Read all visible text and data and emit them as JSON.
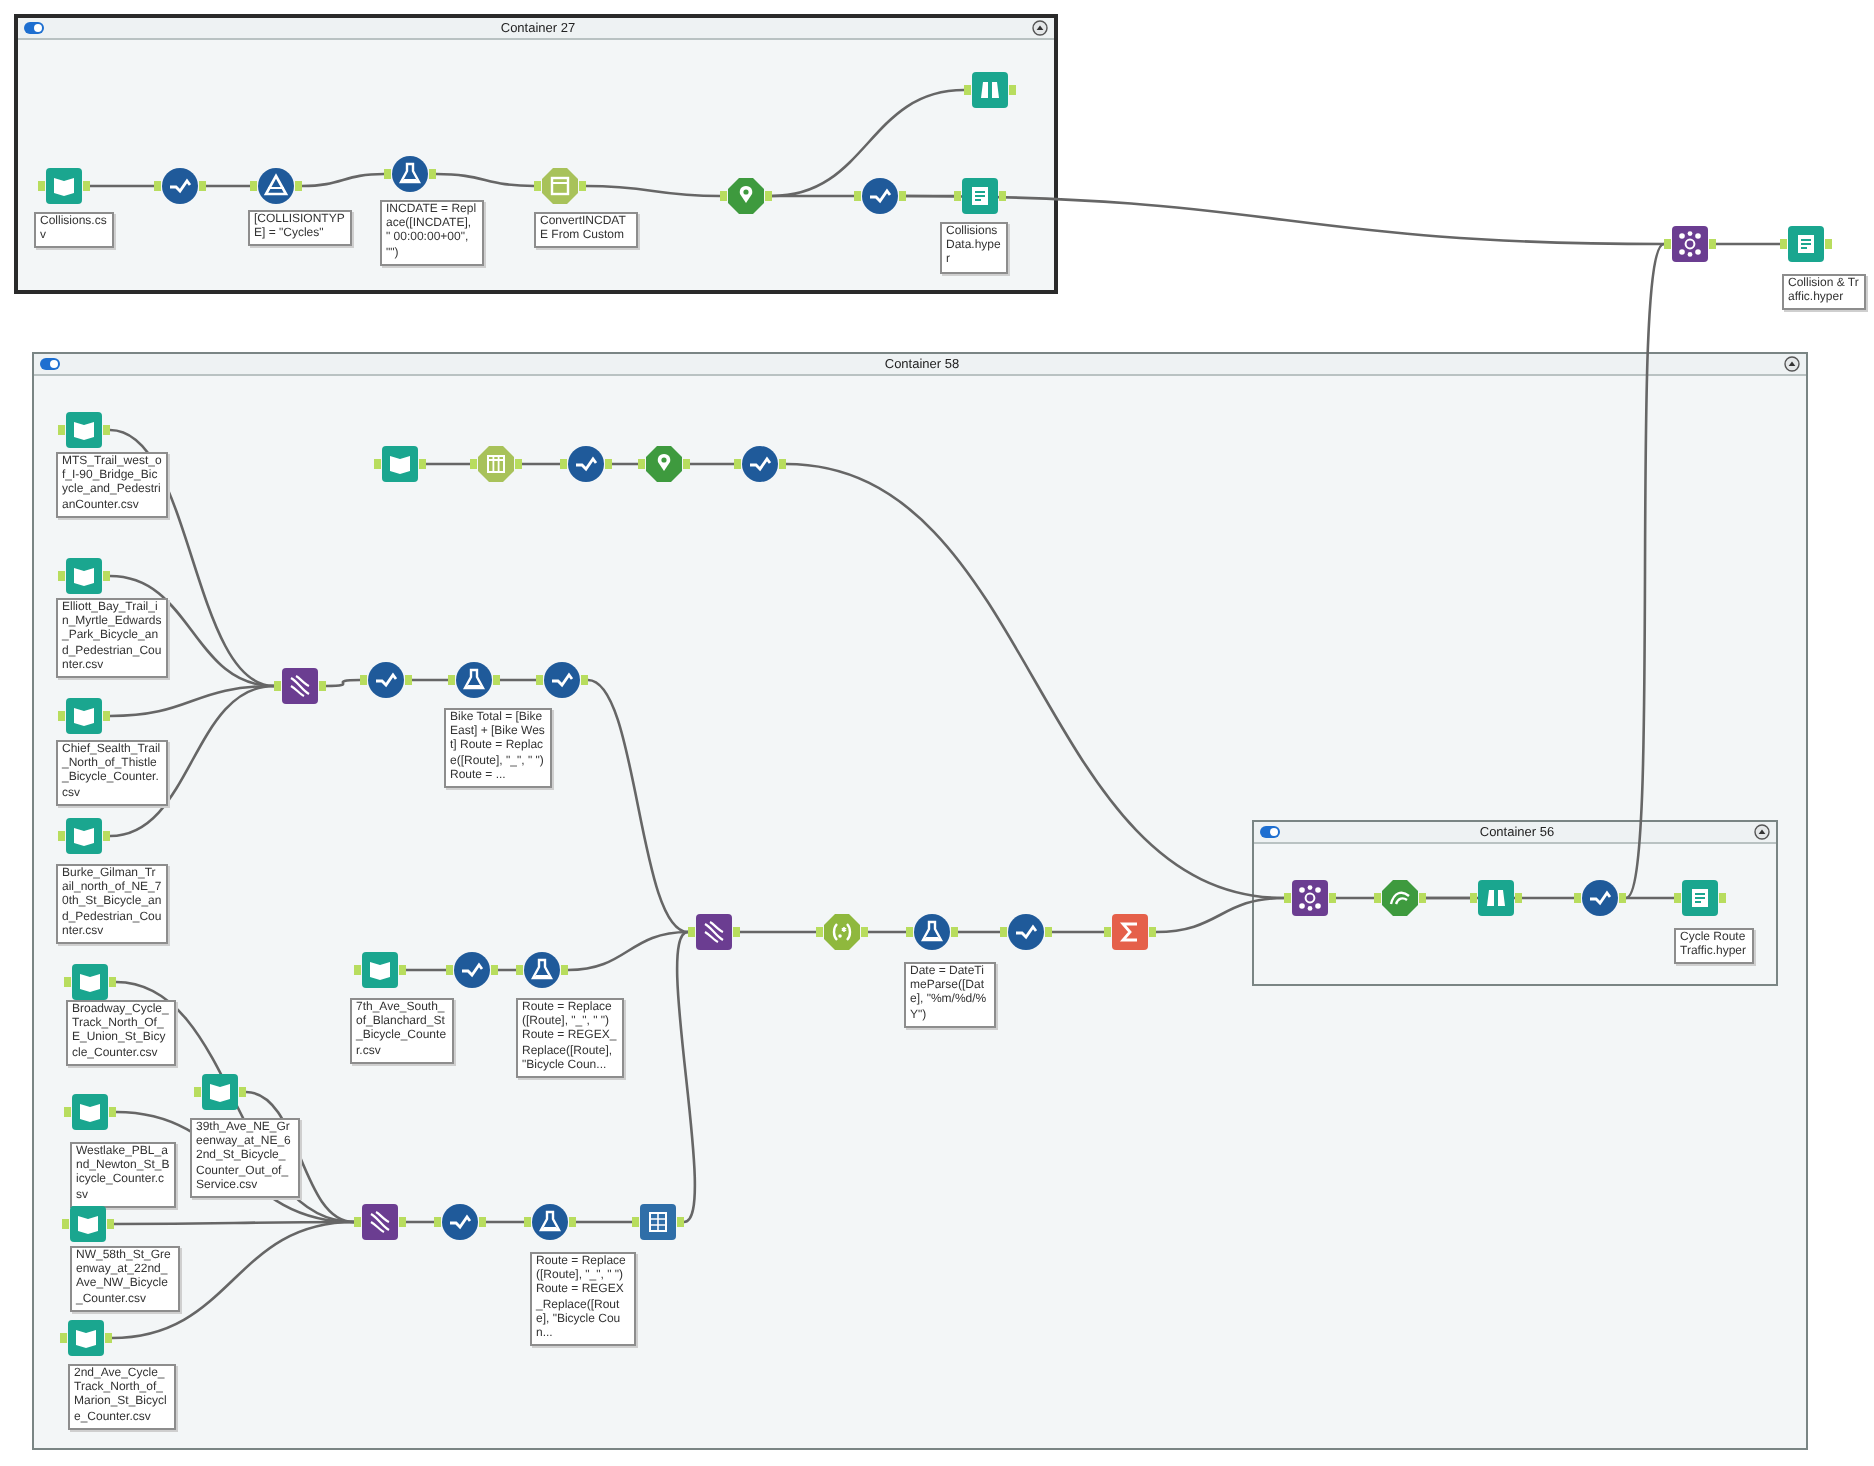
{
  "containers": [
    {
      "title": "Container 27",
      "enabled": true,
      "nodes": [
        {
          "kind": "input",
          "label": "Collisions.csv"
        },
        {
          "kind": "select"
        },
        {
          "kind": "filter",
          "label": "[COLLISIONTYPE] = \"Cycles\""
        },
        {
          "kind": "formula",
          "label": "INCDATE = Replace([INCDATE], \" 00:00:00+00\", \"\")"
        },
        {
          "kind": "datetime",
          "label": "ConvertINCDATE From Custom"
        },
        {
          "kind": "spatial"
        },
        {
          "kind": "browse"
        },
        {
          "kind": "select"
        },
        {
          "kind": "output",
          "label": "Collisions Data.hyper"
        }
      ]
    },
    {
      "title": "Container 58",
      "enabled": true,
      "nodes": [
        {
          "kind": "input",
          "label": "MTS_Trail_west_of_I-90_Bridge_Bicycle_and_PedestrianCounter.csv"
        },
        {
          "kind": "input",
          "label": "Elliott_Bay_Trail_in_Myrtle_Edwards_Park_Bicycle_and_Pedestrian_Counter.csv"
        },
        {
          "kind": "input",
          "label": "Chief_Sealth_Trail_North_of_Thistle_Bicycle_Counter.csv"
        },
        {
          "kind": "input",
          "label": "Burke_Gilman_Trail_north_of_NE_70th_St_Bicycle_and_Pedestrian_Counter.csv"
        },
        {
          "kind": "union"
        },
        {
          "kind": "select"
        },
        {
          "kind": "formula",
          "label": "Bike Total = [Bike East] + [Bike West] Route = Replace([Route], \"_\", \" \") Route = ..."
        },
        {
          "kind": "select"
        },
        {
          "kind": "input"
        },
        {
          "kind": "texttocols"
        },
        {
          "kind": "select"
        },
        {
          "kind": "spatial"
        },
        {
          "kind": "select"
        },
        {
          "kind": "input",
          "label": "7th_Ave_South_of_Blanchard_St_Bicycle_Counter.csv"
        },
        {
          "kind": "select"
        },
        {
          "kind": "formula",
          "label": "Route = Replace([Route], \"_\", \" \") Route = REGEX_Replace([Route], \"Bicycle Coun..."
        },
        {
          "kind": "union"
        },
        {
          "kind": "regex"
        },
        {
          "kind": "formula",
          "label": "Date = DateTimeParse([Date], \"%m/%d/%Y\")"
        },
        {
          "kind": "select"
        },
        {
          "kind": "summarize"
        },
        {
          "kind": "input",
          "label": "Broadway_Cycle_Track_North_Of_E_Union_St_Bicycle_Counter.csv"
        },
        {
          "kind": "input",
          "label": "Westlake_PBL_and_Newton_St_Bicycle_Counter.csv"
        },
        {
          "kind": "input",
          "label": "39th_Ave_NE_Greenway_at_NE_62nd_St_Bicycle_Counter_Out_of_Service.csv"
        },
        {
          "kind": "input",
          "label": "NW_58th_St_Greenway_at_22nd_Ave_NW_Bicycle_Counter.csv"
        },
        {
          "kind": "input",
          "label": "2nd_Ave_Cycle_Track_North_of_Marion_St_Bicycle_Counter.csv"
        },
        {
          "kind": "union"
        },
        {
          "kind": "select"
        },
        {
          "kind": "formula",
          "label": "Route = Replace([Route], \"_\", \" \") Route = REGEX_Replace([Route], \"Bicycle Coun..."
        },
        {
          "kind": "multirow"
        }
      ]
    },
    {
      "title": "Container 56",
      "enabled": true,
      "nodes": [
        {
          "kind": "join"
        },
        {
          "kind": "buffer"
        },
        {
          "kind": "browse"
        },
        {
          "kind": "select"
        },
        {
          "kind": "output",
          "label": "Cycle Route Traffic.hyper"
        }
      ]
    }
  ],
  "nodes": [
    {
      "kind": "join"
    },
    {
      "kind": "output",
      "label": "Collision & Traffic.hyper"
    }
  ]
}
